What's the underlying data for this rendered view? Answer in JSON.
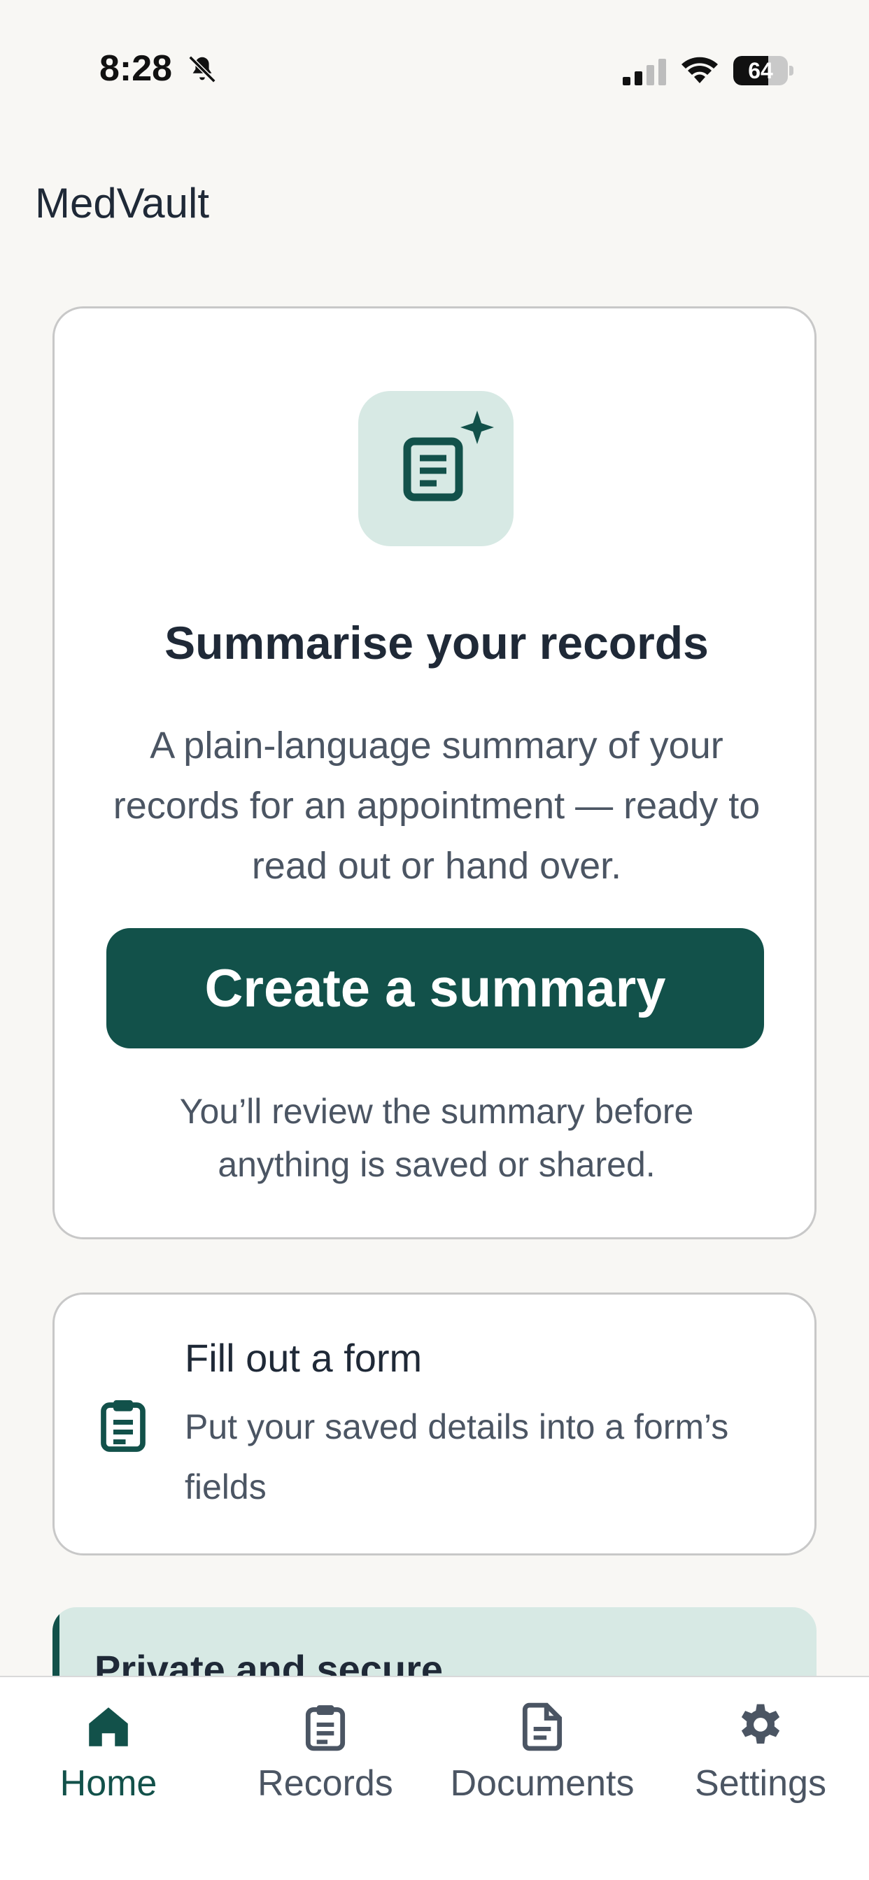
{
  "status_bar": {
    "time": "8:28",
    "battery_percent": "64",
    "battery_level": 0.64
  },
  "header": {
    "app_title": "MedVault"
  },
  "hero": {
    "icon": "document-sparkle-icon",
    "title": "Summarise your records",
    "description": "A plain-language summary of your records for an appointment — ready to read out or hand over.",
    "button_label": "Create a summary",
    "note": "You’ll review the summary before anything is saved or shared."
  },
  "form_card": {
    "icon": "clipboard-icon",
    "title": "Fill out a form",
    "description": "Put your saved details into a form’s fields"
  },
  "private_card": {
    "title": "Private and secure"
  },
  "nav": {
    "items": [
      {
        "label": "Home",
        "icon": "home-icon",
        "active": true
      },
      {
        "label": "Records",
        "icon": "clipboard-icon",
        "active": false
      },
      {
        "label": "Documents",
        "icon": "document-icon",
        "active": false
      },
      {
        "label": "Settings",
        "icon": "gear-icon",
        "active": false
      }
    ]
  },
  "colors": {
    "accent": "#12514a",
    "accent_tint": "#d7e9e4",
    "background": "#f8f7f4",
    "text_primary": "#1f2937",
    "text_secondary": "#4b5563"
  }
}
